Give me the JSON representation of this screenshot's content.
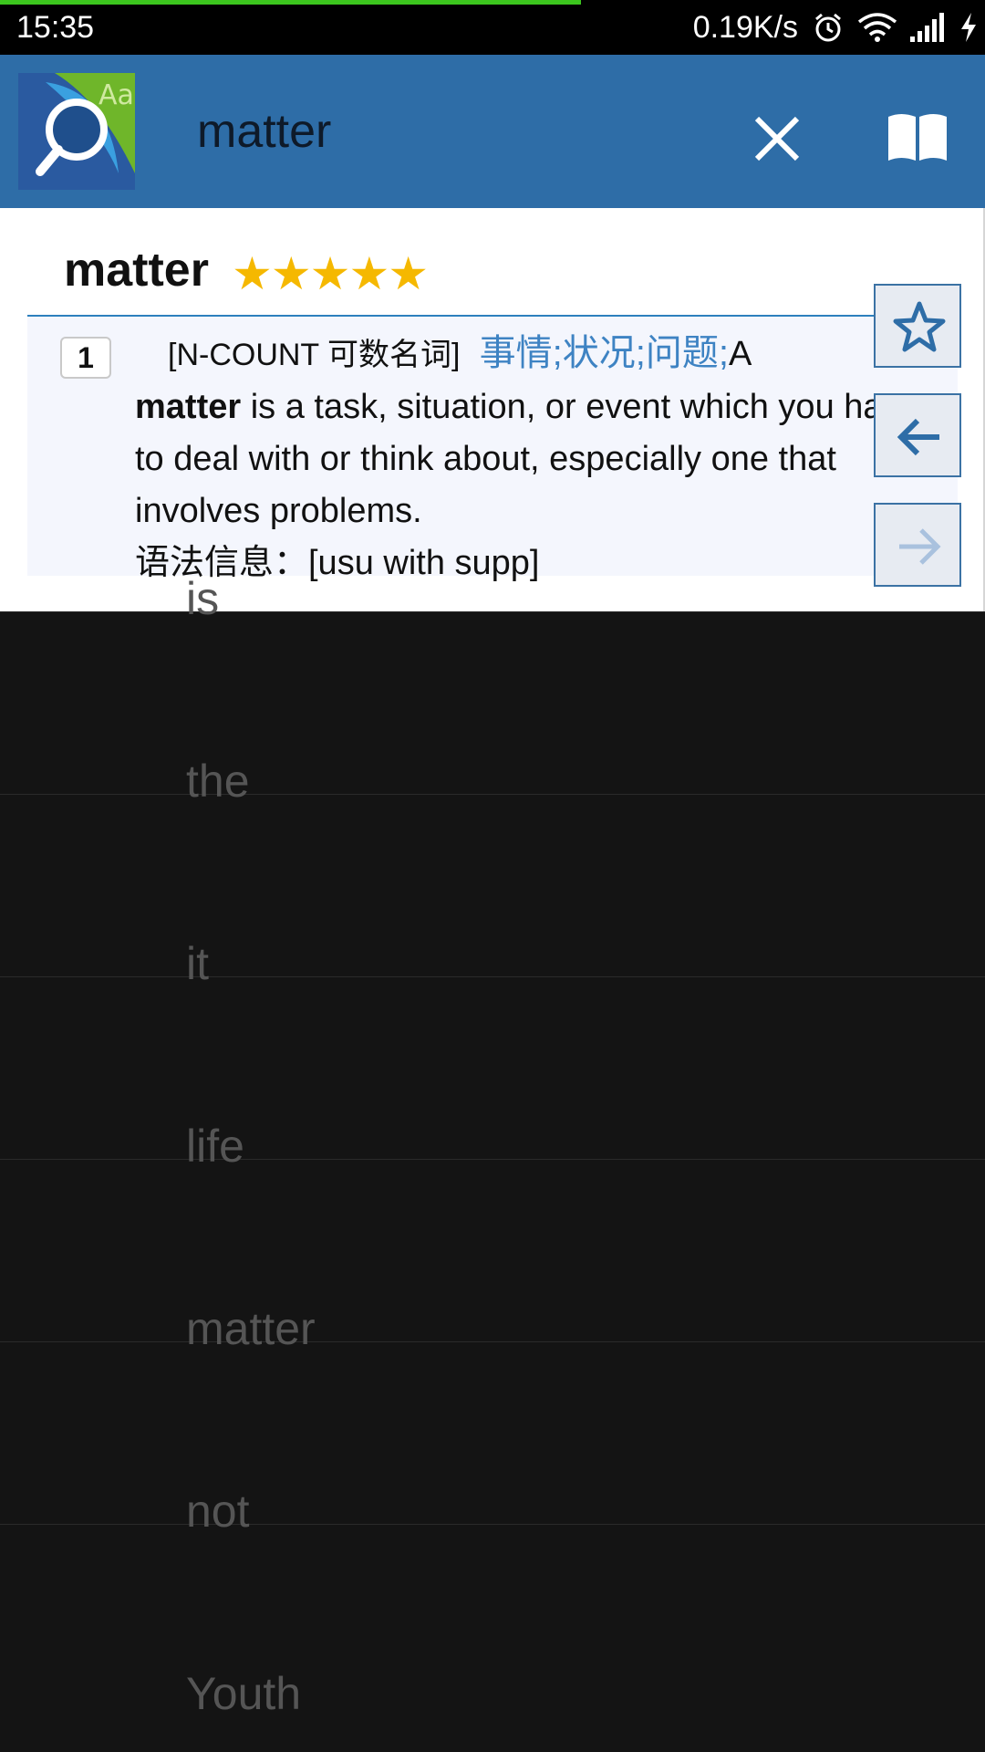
{
  "status_bar": {
    "time": "15:35",
    "net_speed": "0.19K/s",
    "icons": [
      "alarm-icon",
      "wifi-icon",
      "signal-icon",
      "charging-icon"
    ]
  },
  "app_bar": {
    "search_value": "matter",
    "logo_icon": "dictionary-search-logo",
    "close_icon": "close-icon",
    "book_icon": "open-book-icon",
    "color": "#2e6da7"
  },
  "entry": {
    "headword": "matter",
    "stars": "★★★★★",
    "sense_number": "1",
    "pos": "[N-COUNT 可数名词]",
    "chinese": "事情;状况;问题;",
    "def_lead": "A",
    "def_bold": "matter",
    "definition": " is a task, situation, or event which you have to deal with or think about, especially one that involves problems.",
    "grammar": "语法信息：[usu with supp]"
  },
  "side_buttons": [
    "star-icon",
    "back-arrow-icon",
    "forward-arrow-icon"
  ],
  "word_list": [
    "is",
    "the",
    "it",
    "life",
    "matter",
    "not",
    "Youth"
  ],
  "colors": {
    "accent": "#2e6da7",
    "star": "#f5b800",
    "chinese_text": "#3e83c3"
  }
}
